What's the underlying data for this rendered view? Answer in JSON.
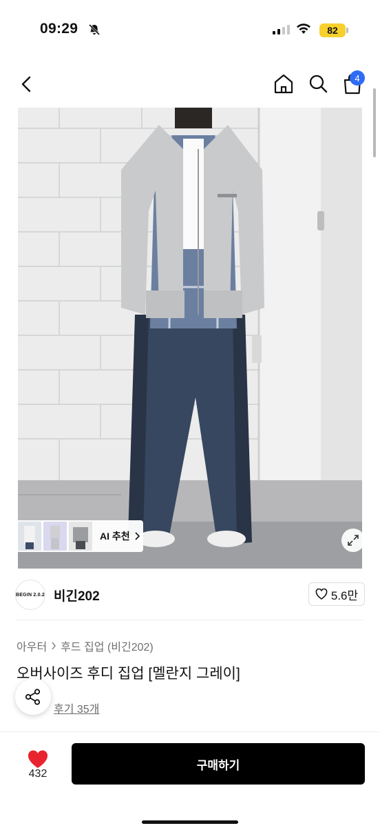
{
  "status_bar": {
    "time": "09:29",
    "battery": "82"
  },
  "nav": {
    "cart_count": "4"
  },
  "hero": {
    "ai_label": "AI 추천"
  },
  "brand": {
    "logo_text": "BEGIN 2.0.2",
    "name": "비긴202",
    "likes": "5.6만"
  },
  "breadcrumb": {
    "category": "아우터",
    "subcategory": "후드 집업 (비긴202)"
  },
  "product": {
    "title": "오버사이즈 후디 집업 [멜란지 그레이]",
    "review_label": "후기 35개"
  },
  "bottom": {
    "heart_count": "432",
    "buy_label": "구매하기"
  },
  "colors": {
    "accent_blue": "#2e6cf6",
    "heart_red": "#e8242f",
    "buy_black": "#000000"
  }
}
